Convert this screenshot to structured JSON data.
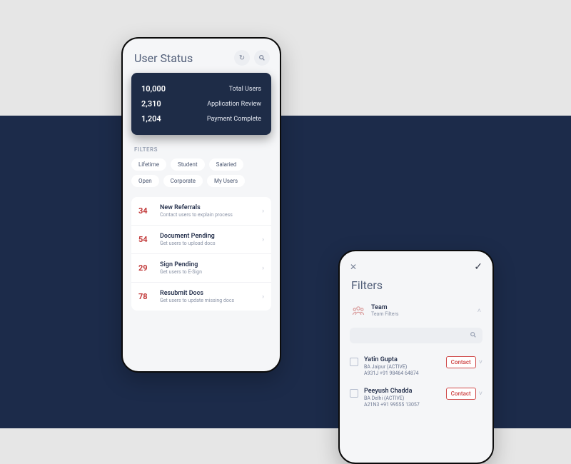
{
  "phone1": {
    "title": "User Status",
    "stats": [
      {
        "value": "10,000",
        "label": "Total Users"
      },
      {
        "value": "2,310",
        "label": "Application Review"
      },
      {
        "value": "1,204",
        "label": "Payment Complete"
      }
    ],
    "filters_label": "FILTERS",
    "chips": [
      "Lifetime",
      "Student",
      "Salaried",
      "Open",
      "Corporate",
      "My Users"
    ],
    "tasks": [
      {
        "count": "34",
        "title": "New Referrals",
        "sub": "Contact users to explain process"
      },
      {
        "count": "54",
        "title": "Document Pending",
        "sub": "Get users to upload docs"
      },
      {
        "count": "29",
        "title": "Sign Pending",
        "sub": "Get users to E-Sign"
      },
      {
        "count": "78",
        "title": "Resubmit Docs",
        "sub": "Get users to update missing docs"
      }
    ]
  },
  "phone2": {
    "title": "Filters",
    "team": {
      "title": "Team",
      "sub": "Team Filters"
    },
    "contact_label": "Contact",
    "people": [
      {
        "name": "Yatin Gupta",
        "line1": "BA Jaipur (ACTIVE)",
        "line2": "A931J +91 98464 64874"
      },
      {
        "name": "Peeyush Chadda",
        "line1": "BA Delhi (ACTIVE)",
        "line2": "A21N3 +91 99555 13057"
      }
    ]
  }
}
